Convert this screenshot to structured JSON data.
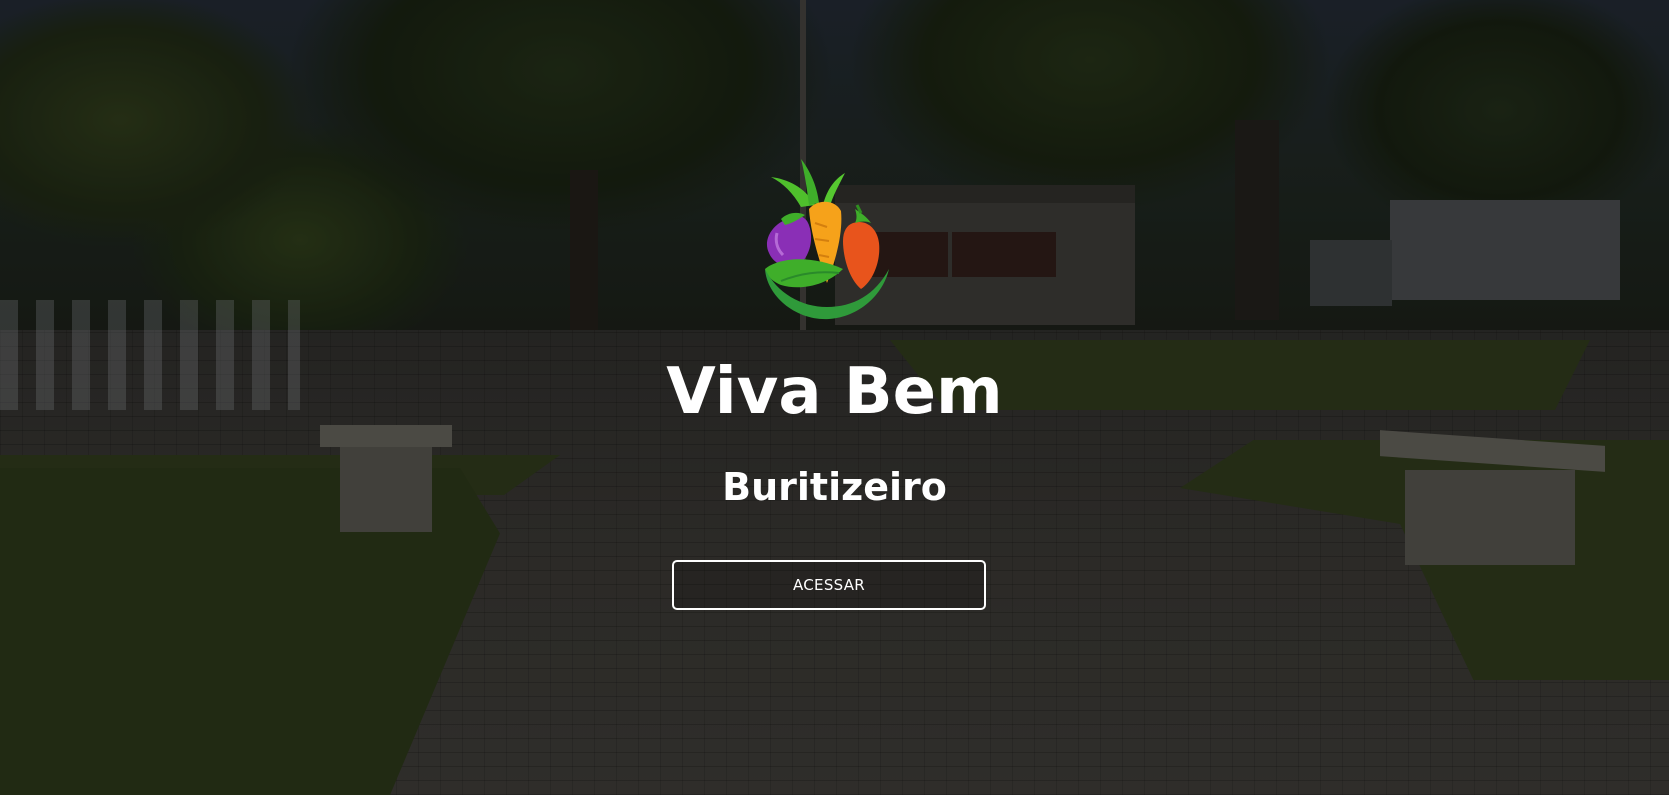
{
  "hero": {
    "title": "Viva Bem",
    "subtitle": "Buritizeiro",
    "cta_label": "ACESSAR",
    "logo": {
      "icon": "vegetables-logo-icon",
      "colors": {
        "eggplant": "#8a2fb6",
        "carrot": "#f6a21a",
        "pepper": "#e8541c",
        "leaf": "#3fae2a",
        "bowl": "#2f9a3a"
      }
    }
  },
  "colors": {
    "text": "#ffffff",
    "overlay": "rgba(0,0,0,0.38)"
  }
}
